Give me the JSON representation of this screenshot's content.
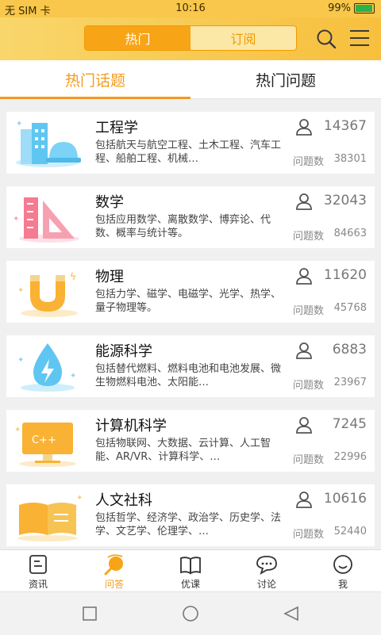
{
  "status": {
    "carrier": "无 SIM 卡",
    "time": "10:16",
    "battery": "99%"
  },
  "header": {
    "seg_hot": "热门",
    "seg_sub": "订阅"
  },
  "tabs": {
    "topics": "热门话题",
    "questions": "热门问题"
  },
  "topics": [
    {
      "name": "工程学",
      "desc": "包括航天与航空工程、土木工程、汽车工程、船舶工程、机械…",
      "followers": "14367",
      "questions_label": "问题数",
      "questions": "38301",
      "icon": "building-helmet-icon"
    },
    {
      "name": "数学",
      "desc": "包括应用数学、离散数学、博弈论、代数、概率与统计等。",
      "followers": "32043",
      "questions_label": "问题数",
      "questions": "84663",
      "icon": "ruler-triangle-icon"
    },
    {
      "name": "物理",
      "desc": "包括力学、磁学、电磁学、光学、热学、量子物理等。",
      "followers": "11620",
      "questions_label": "问题数",
      "questions": "45768",
      "icon": "magnet-icon"
    },
    {
      "name": "能源科学",
      "desc": "包括替代燃料、燃料电池和电池发展、微生物燃料电池、太阳能…",
      "followers": "6883",
      "questions_label": "问题数",
      "questions": "23967",
      "icon": "energy-drop-icon"
    },
    {
      "name": "计算机科学",
      "desc": "包括物联网、大数据、云计算、人工智能、AR/VR、计算科学、…",
      "followers": "7245",
      "questions_label": "问题数",
      "questions": "22996",
      "icon": "cpp-monitor-icon"
    },
    {
      "name": "人文社科",
      "desc": "包括哲学、经济学、政治学、历史学、法学、文艺学、伦理学、…",
      "followers": "10616",
      "questions_label": "问题数",
      "questions": "52440",
      "icon": "open-book-icon"
    }
  ],
  "nav": [
    {
      "label": "资讯",
      "icon": "news-icon"
    },
    {
      "label": "问答",
      "icon": "qa-icon"
    },
    {
      "label": "优课",
      "icon": "book-icon"
    },
    {
      "label": "讨论",
      "icon": "chat-icon"
    },
    {
      "label": "我",
      "icon": "smiley-icon"
    }
  ],
  "colors": {
    "accent": "#f39b1c",
    "header": "#f8c74b"
  }
}
